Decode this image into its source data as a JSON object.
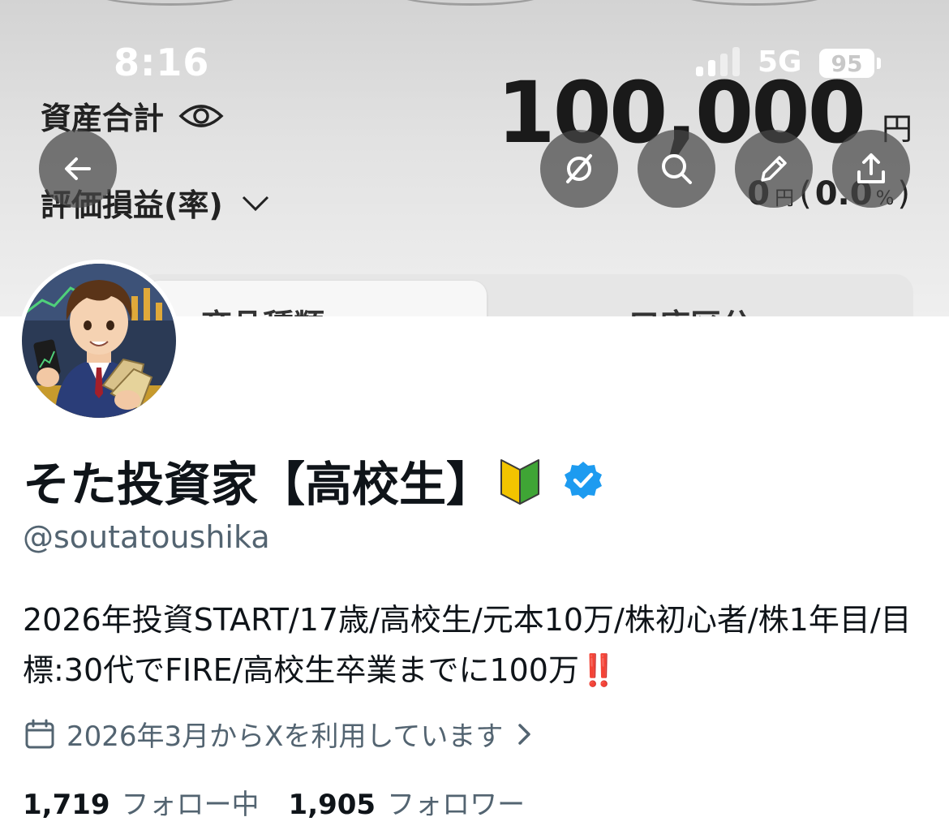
{
  "status_bar": {
    "time": "8:16",
    "network": "5G",
    "battery": "95"
  },
  "portfolio": {
    "asset_label": "資産合計",
    "asset_amount": "100,000",
    "asset_unit": "円",
    "pl_label": "評価損益(率)",
    "pl_value": "0",
    "pl_unit": "円",
    "pl_open": "(",
    "pl_rate": "0.0",
    "pl_rate_unit": "%",
    "pl_close": ")",
    "tabs": [
      "商品種類",
      "口座区分"
    ]
  },
  "profile": {
    "display_name": "そた投資家【高校生】",
    "handle": "@soutatoushika",
    "bio": "2026年投資START/17歳/高校生/元本10万/株初心者/株1年目/目標:30代でFIRE/高校生卒業までに100万‼️",
    "joined": "2026年3月からXを利用しています",
    "following_count": "1,719",
    "following_label": "フォロー中",
    "followers_count": "1,905",
    "followers_label": "フォロワー"
  },
  "icons": {
    "back": "arrow-left-icon",
    "grok": "grok-icon",
    "search": "search-icon",
    "edit": "pencil-icon",
    "share": "share-icon",
    "verified": "verified-badge-icon",
    "beginner": "beginner-mark-icon",
    "calendar": "calendar-icon"
  },
  "colors": {
    "verified": "#1d9bf0",
    "secondary_text": "#536471"
  }
}
